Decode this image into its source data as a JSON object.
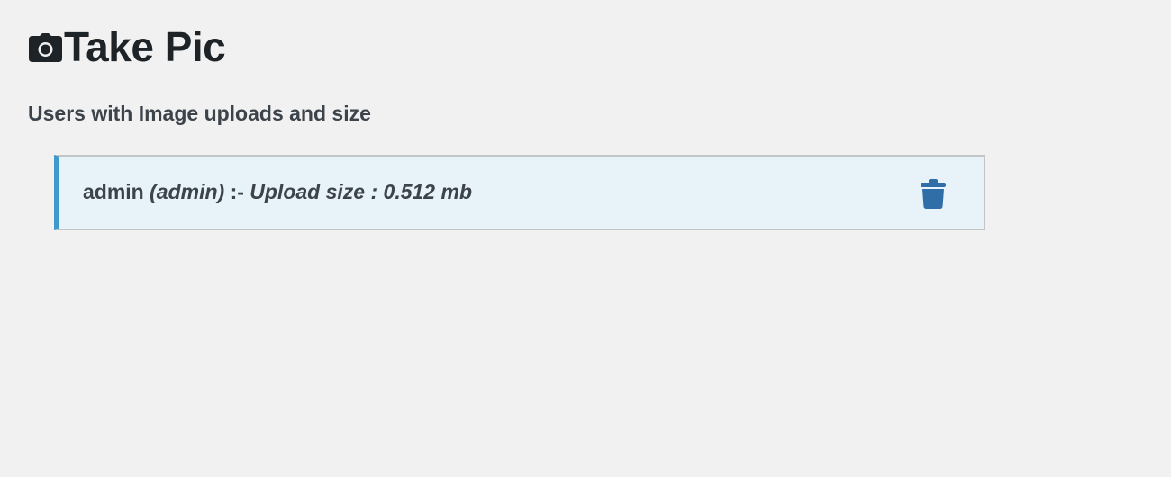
{
  "header": {
    "icon": "camera-icon",
    "title": "Take Pic"
  },
  "section": {
    "subtitle": "Users with Image uploads and size"
  },
  "users": [
    {
      "name": "admin",
      "login": "(admin)",
      "separator": ":-",
      "upload_label": "Upload size :",
      "upload_size": "0.512 mb",
      "delete_icon": "trash-icon"
    }
  ],
  "colors": {
    "background": "#f1f1f1",
    "row_background": "#e8f2f9",
    "row_accent": "#3f9acb",
    "delete_icon": "#2f6ea6"
  }
}
